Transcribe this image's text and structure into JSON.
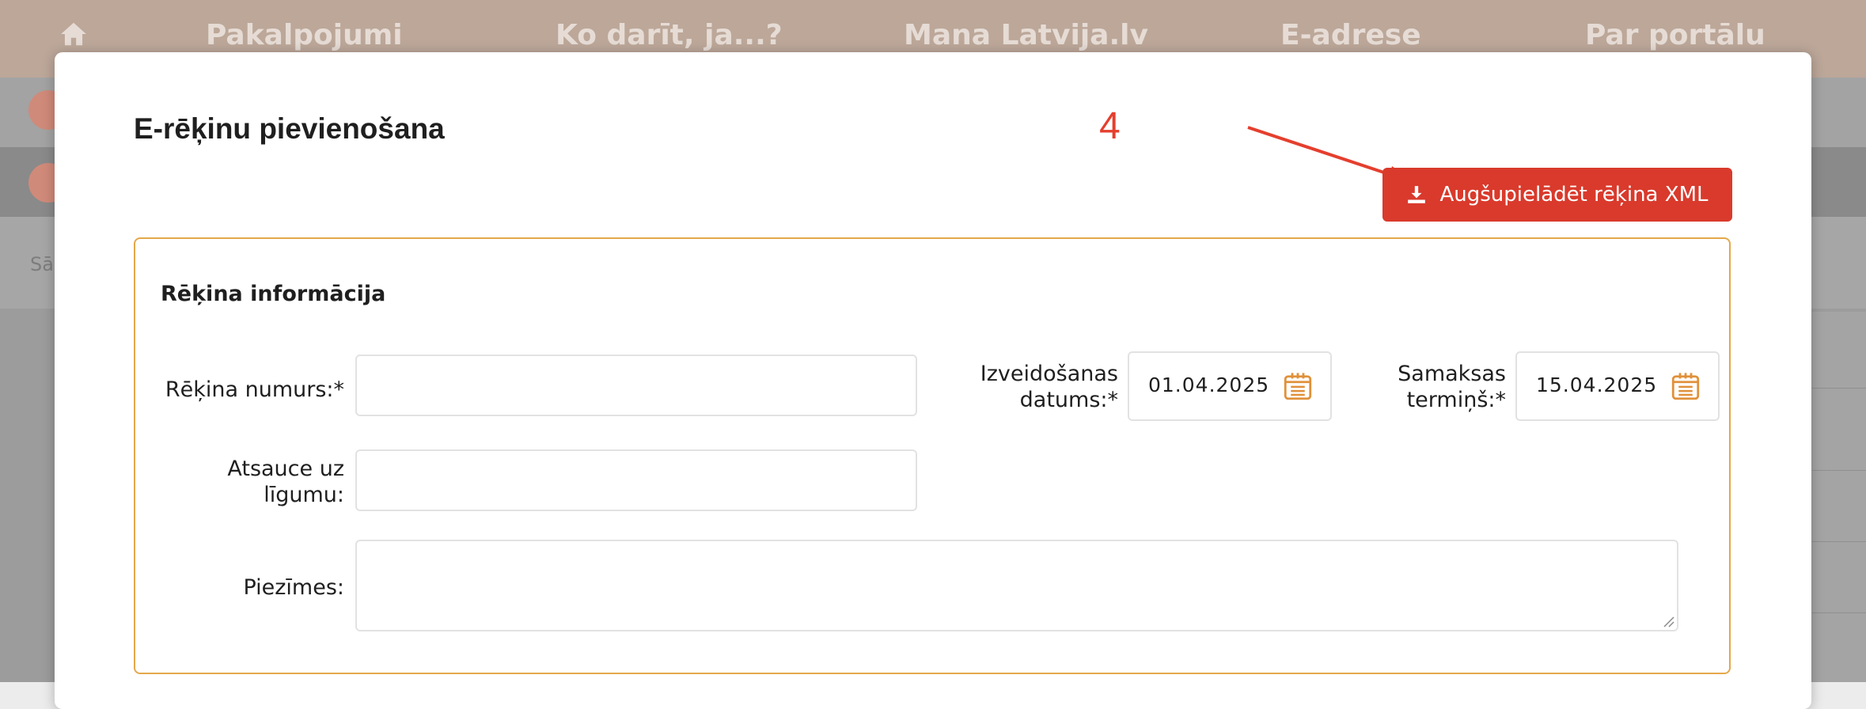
{
  "nav": {
    "items": [
      "Pakalpojumi",
      "Ko darīt, ja...?",
      "Mana Latvija.lv",
      "E-adrese",
      "Par portālu"
    ]
  },
  "background": {
    "breadcrumb": "Sāk"
  },
  "modal": {
    "title": "E-rēķinu pievienošana",
    "annotation_step": "4",
    "upload_button_label": "Augšupielādēt rēķina XML",
    "panel": {
      "title": "Rēķina informācija",
      "invoice_number": {
        "label": "Rēķina numurs:*",
        "value": ""
      },
      "created_date": {
        "label_line1": "Izveidošanas",
        "label_line2": "datums:*",
        "value": "01.04.2025"
      },
      "due_date": {
        "label_line1": "Samaksas",
        "label_line2": "termiņš:*",
        "value": "15.04.2025"
      },
      "contract_ref": {
        "label_line1": "Atsauce uz",
        "label_line2": "līgumu:",
        "value": ""
      },
      "notes": {
        "label": "Piezīmes:",
        "value": ""
      }
    }
  },
  "colors": {
    "nav_bg": "#bca799",
    "accent_red": "#d93a2c",
    "annotation_red": "#e53f2e",
    "panel_border": "#e4a84a",
    "calendar_icon": "#e0913a"
  },
  "icons": [
    "home-icon",
    "download-icon",
    "calendar-icon",
    "arrow-annotation"
  ]
}
